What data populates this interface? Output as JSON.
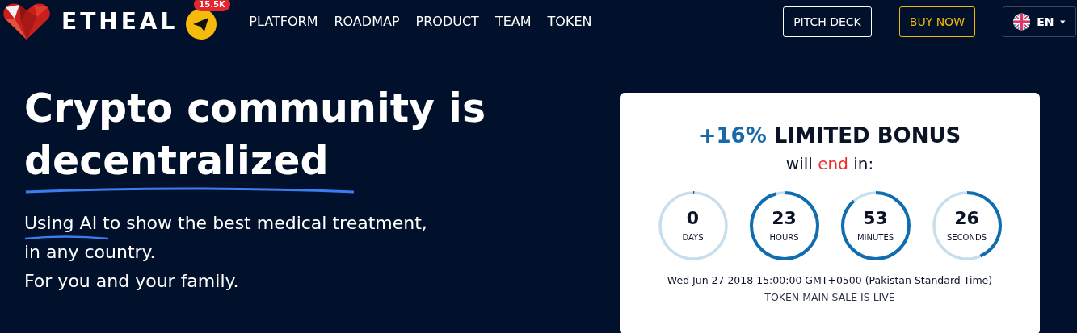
{
  "header": {
    "brand": "ETHEAL",
    "badge": "15.5K",
    "nav": [
      {
        "label": "PLATFORM"
      },
      {
        "label": "ROADMAP"
      },
      {
        "label": "PRODUCT"
      },
      {
        "label": "TEAM"
      },
      {
        "label": "TOKEN"
      }
    ],
    "buttons": [
      {
        "label": "PITCH DECK",
        "kind": "outline"
      },
      {
        "label": "BUY NOW",
        "kind": "accent"
      }
    ],
    "language": "EN"
  },
  "hero": {
    "headline": [
      "Crypto community is",
      "decentralized"
    ],
    "lines": [
      "Using AI to show the best medical treatment,",
      "in any country.",
      "For you and your family."
    ]
  },
  "bonus": {
    "accent": "+16%",
    "title": "LIMITED BONUS",
    "before": "will",
    "highlight": "end",
    "after": "in:",
    "countdown": [
      {
        "value": "0",
        "unit": "DAYS"
      },
      {
        "value": "23",
        "unit": "HOURS"
      },
      {
        "value": "53",
        "unit": "MINUTES"
      },
      {
        "value": "26",
        "unit": "SECONDS"
      }
    ],
    "date": "Wed Jun 27 2018 15:00:00 GMT+0500 (Pakistan Standard Time)",
    "status": "TOKEN MAIN SALE IS LIVE"
  }
}
